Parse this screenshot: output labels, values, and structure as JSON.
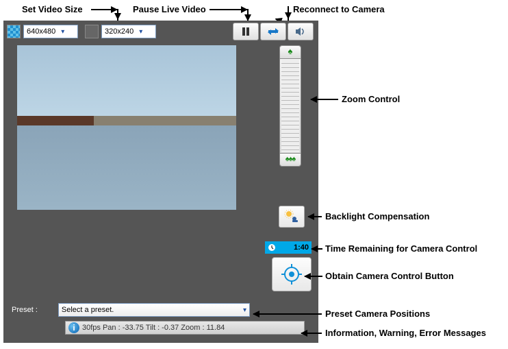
{
  "annotations": {
    "set_video_size": "Set Video Size",
    "pause_live": "Pause Live Video",
    "reconnect": "Reconnect to Camera",
    "zoom_control": "Zoom Control",
    "backlight": "Backlight Compensation",
    "time_remaining": "Time Remaining for Camera Control",
    "obtain_control": "Obtain Camera Control Button",
    "preset_positions": "Preset Camera Positions",
    "status_msgs": "Information, Warning, Error Messages"
  },
  "toolbar": {
    "size1": "640x480",
    "size2": "320x240"
  },
  "time": {
    "value": "1:40"
  },
  "preset": {
    "label": "Preset :",
    "placeholder": "Select a preset."
  },
  "status": {
    "text": "30fps Pan : -33.75 Tilt : -0.37 Zoom : 11.84"
  }
}
